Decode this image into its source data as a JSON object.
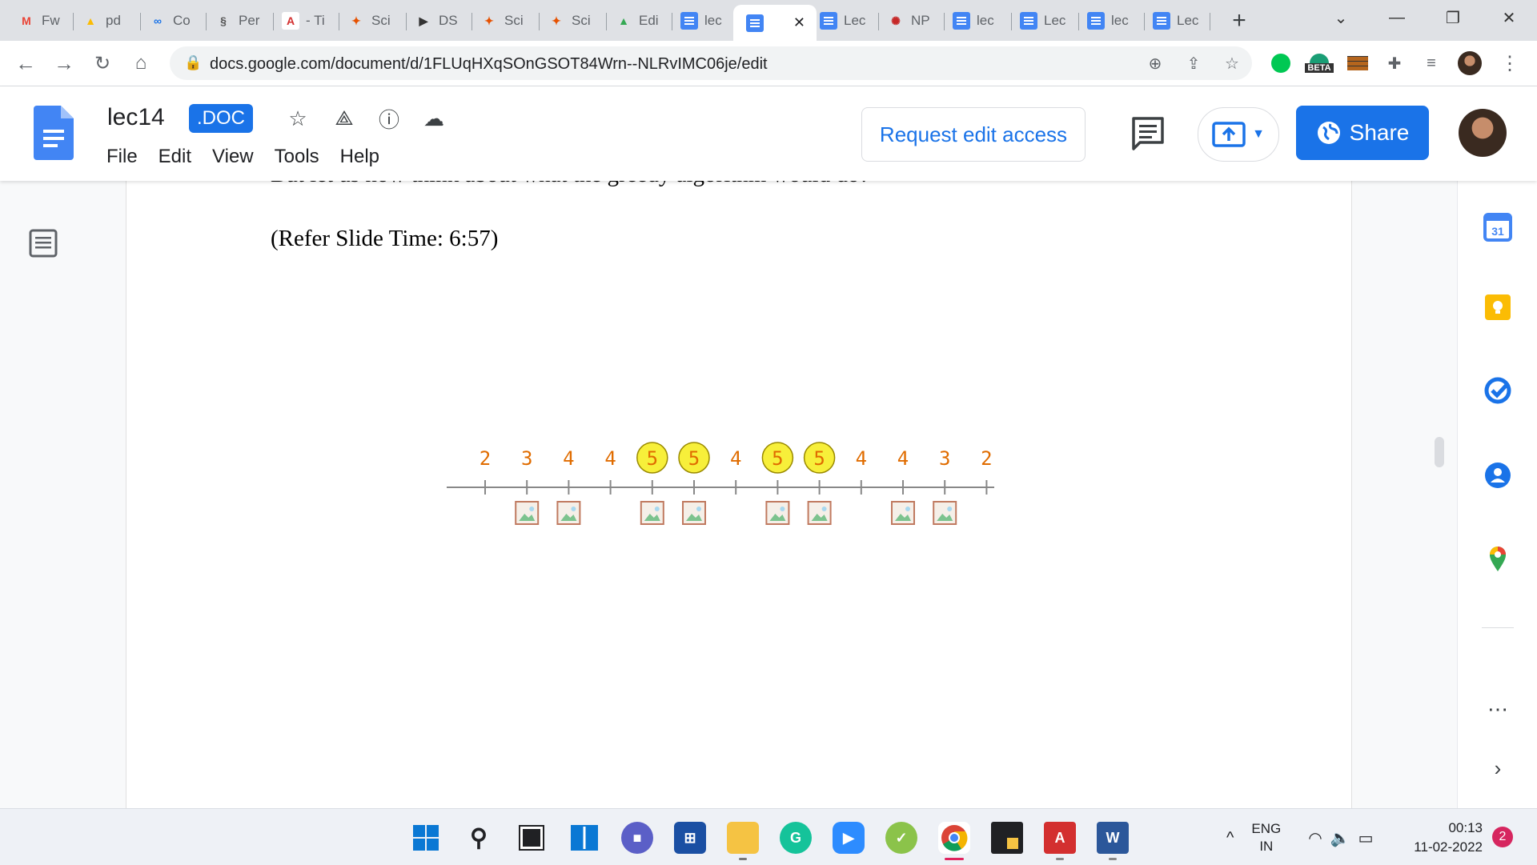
{
  "browser": {
    "tabs": [
      {
        "label": "Fw",
        "icon": "gmail-icon",
        "glyph": "M",
        "color": "#ea4335",
        "bg": "transparent"
      },
      {
        "label": "pd",
        "icon": "drive-icon",
        "glyph": "▲",
        "color": "#fbbc04",
        "bg": "transparent"
      },
      {
        "label": "Co",
        "icon": "link-icon",
        "glyph": "∞",
        "color": "#1a73e8",
        "bg": "transparent"
      },
      {
        "label": "Per",
        "icon": "perplexity-icon",
        "glyph": "§",
        "color": "#555",
        "bg": "transparent"
      },
      {
        "label": "- Ti",
        "icon": "acrobat-icon",
        "glyph": "A",
        "color": "#d32f2f",
        "bg": "#fff"
      },
      {
        "label": "Sci",
        "icon": "sci-hub-icon",
        "glyph": "✦",
        "color": "#e65100",
        "bg": "transparent"
      },
      {
        "label": "DS",
        "icon": "dsa-icon",
        "glyph": "▶",
        "color": "#333",
        "bg": "transparent"
      },
      {
        "label": "Sci",
        "icon": "sci-hub-icon",
        "glyph": "✦",
        "color": "#e65100",
        "bg": "transparent"
      },
      {
        "label": "Sci",
        "icon": "sci-hub-icon",
        "glyph": "✦",
        "color": "#e65100",
        "bg": "transparent"
      },
      {
        "label": "Edi",
        "icon": "drive-icon",
        "glyph": "▲",
        "color": "#34a853",
        "bg": "transparent"
      },
      {
        "label": "lec",
        "icon": "docs-icon",
        "glyph": "",
        "color": "#fff",
        "bg": "docs"
      },
      {
        "label": "",
        "icon": "docs-icon",
        "glyph": "",
        "color": "#fff",
        "bg": "docs",
        "active": true
      },
      {
        "label": "Lec",
        "icon": "docs-icon",
        "glyph": "",
        "color": "#fff",
        "bg": "docs"
      },
      {
        "label": "NP",
        "icon": "nptel-icon",
        "glyph": "✺",
        "color": "#c62828",
        "bg": "transparent"
      },
      {
        "label": "lec",
        "icon": "docs-icon",
        "glyph": "",
        "color": "#fff",
        "bg": "docs"
      },
      {
        "label": "Lec",
        "icon": "docs-icon",
        "glyph": "",
        "color": "#fff",
        "bg": "docs"
      },
      {
        "label": "lec",
        "icon": "docs-icon",
        "glyph": "",
        "color": "#fff",
        "bg": "docs"
      },
      {
        "label": "Lec",
        "icon": "docs-icon",
        "glyph": "",
        "color": "#fff",
        "bg": "docs"
      }
    ],
    "url": "docs.google.com/document/d/1FLUqHXqSOnGSOT84Wrn--NLRvIMC06je/edit",
    "beta_label": "BETA"
  },
  "docs": {
    "title": "lec14",
    "badge": ".DOC",
    "menu": [
      "File",
      "Edit",
      "View",
      "Tools",
      "Help"
    ],
    "request_access": "Request edit access",
    "share": "Share"
  },
  "document": {
    "cut_line": "But let us now think about what the greedy algorithm would do?",
    "slide_time": "(Refer Slide Time: 6:57)",
    "figure": {
      "numbers": [
        "2",
        "3",
        "4",
        "4",
        "5",
        "5",
        "4",
        "5",
        "5",
        "4",
        "4",
        "3",
        "2"
      ],
      "highlighted": [
        4,
        5,
        7,
        8
      ],
      "images_at": [
        1,
        2,
        4,
        5,
        7,
        8,
        10,
        11
      ],
      "number_color": "#e06c00",
      "highlight_fill": "#f7ef3a"
    }
  },
  "taskbar": {
    "lang_top": "ENG",
    "lang_bottom": "IN",
    "time": "00:13",
    "date": "11-02-2022",
    "notifications": "2"
  }
}
